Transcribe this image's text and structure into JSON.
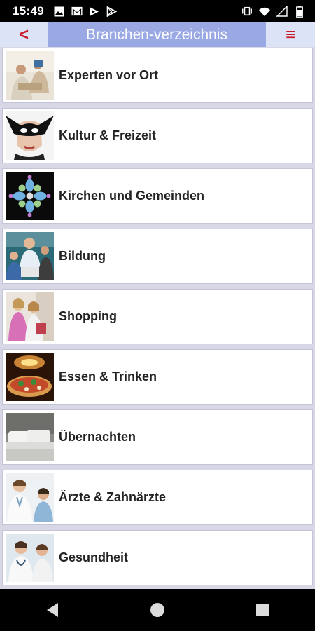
{
  "status_bar": {
    "time": "15:49",
    "left_icons": [
      "image-icon",
      "gmail-icon",
      "flag-icon",
      "play-store-icon"
    ],
    "right_icons": [
      "vibrate-icon",
      "wifi-icon",
      "signal-icon",
      "battery-icon"
    ]
  },
  "header": {
    "back_label": "<",
    "title": "Branchen-verzeichnis",
    "menu_label": "≡"
  },
  "categories": [
    {
      "label": "Experten vor Ort",
      "image": "experts-photo"
    },
    {
      "label": "Kultur & Freizeit",
      "image": "mask-photo"
    },
    {
      "label": "Kirchen und Gemeinden",
      "image": "rose-window-photo"
    },
    {
      "label": "Bildung",
      "image": "education-photo"
    },
    {
      "label": "Shopping",
      "image": "shopping-photo"
    },
    {
      "label": "Essen & Trinken",
      "image": "pizza-photo"
    },
    {
      "label": "Übernachten",
      "image": "hotel-bed-photo"
    },
    {
      "label": "Ärzte & Zahnärzte",
      "image": "doctor-photo"
    },
    {
      "label": "Gesundheit",
      "image": "health-photo"
    }
  ],
  "nav_bar": {
    "buttons": [
      "back-nav-icon",
      "home-nav-icon",
      "recents-nav-icon"
    ]
  }
}
